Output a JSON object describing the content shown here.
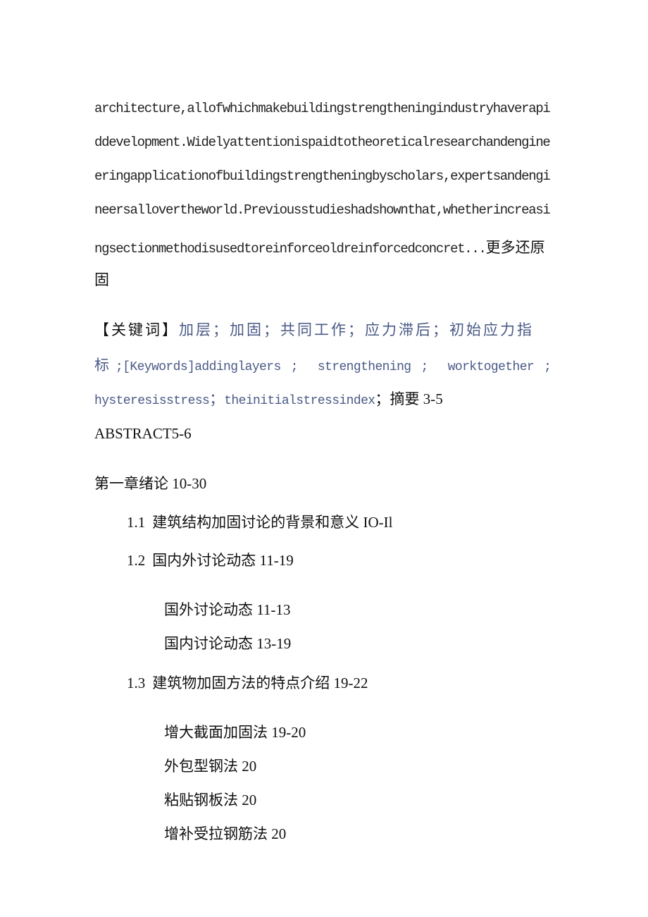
{
  "abstract_en": {
    "lines": [
      "architecture,allofwhichmakebuildingstrengtheningindustryhaverapi",
      "ddevelopment.Widelyattentionispaidtotheoreticalresearchandengine",
      "eringapplicationofbuildingstrengtheningbyscholars,expertsandengi",
      "neersallovertheworld.Previousstudieshadshownthat,whetherincreasi",
      "ngsectionmethodisusedtoreinforceoldreinforcedconcret..."
    ],
    "more_label": "更多还原",
    "trailing_char": "固"
  },
  "keywords": {
    "label": "【关键词】",
    "cn_line1": "加层；加固；共同工作；应力滞后；初始应力指",
    "cn_line2_start": "标",
    "en_label": ";[Keywords]",
    "en_items": [
      "addinglayers",
      "strengthening",
      "worktogether",
      "hysteresisstress",
      "theinitialstressindex"
    ],
    "separator": "；",
    "tail_text": "摘要 3-5"
  },
  "toc": [
    {
      "text": "ABSTRACT5-6",
      "level": 0
    },
    {
      "text": "第一章绪论 10-30",
      "level": 0
    },
    {
      "num": "1.1",
      "text": "建筑结构加固讨论的背景和意义 IO-Il",
      "level": 1
    },
    {
      "num": "1.2",
      "text": "国内外讨论动态 11-19",
      "level": 1
    },
    {
      "text": "国外讨论动态 11-13",
      "level": 2
    },
    {
      "text": "国内讨论动态 13-19",
      "level": 2
    },
    {
      "num": "1.3",
      "text": "建筑物加固方法的特点介绍 19-22",
      "level": 1
    },
    {
      "text": "增大截面加固法 19-20",
      "level": 2
    },
    {
      "text": "外包型钢法 20",
      "level": 2
    },
    {
      "text": "粘贴钢板法 20",
      "level": 2
    },
    {
      "text": "增补受拉钢筋法 20",
      "level": 2
    }
  ],
  "colors": {
    "keyword_text": "#4a5a86",
    "body_text": "#111111"
  }
}
